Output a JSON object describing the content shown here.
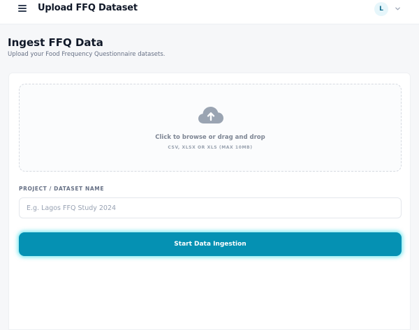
{
  "header": {
    "title": "Upload FFQ Dataset",
    "menu_icon": "hamburger-menu-icon",
    "user_initial": "L",
    "user_menu_icon": "chevron-down-icon"
  },
  "page": {
    "title": "Ingest FFQ Data",
    "subtitle": "Upload your Food Frequency Questionnaire datasets."
  },
  "upload": {
    "icon": "cloud-upload-icon",
    "instruction": "Click to browse or drag and drop",
    "formats": "CSV, XLSX OR XLS (MAX 10MB)"
  },
  "form": {
    "dataset_label": "PROJECT / DATASET NAME",
    "dataset_placeholder": "E.g. Lagos FFQ Study 2024",
    "dataset_value": "",
    "submit_label": "Start Data Ingestion"
  },
  "colors": {
    "accent": "#0591b3",
    "accent_glow": "#14d6e2",
    "avatar_bg": "#e6f6fb",
    "cloud_icon": "#9aa4b2"
  }
}
